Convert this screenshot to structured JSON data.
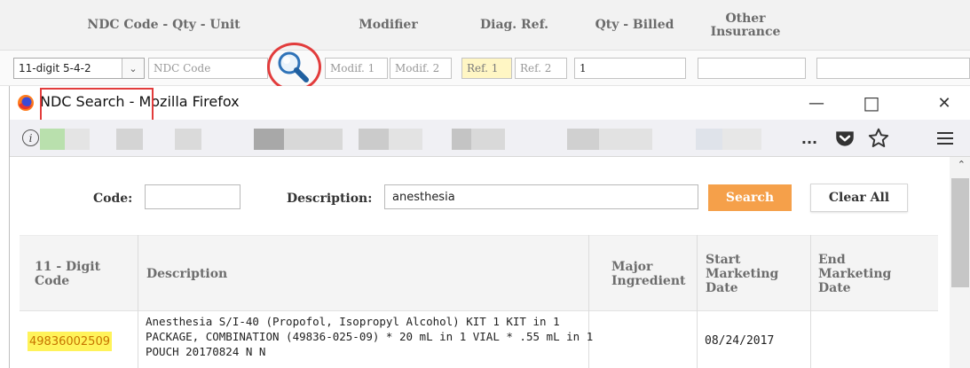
{
  "claim_grid": {
    "headers": [
      "NDC Code - Qty - Unit",
      "Modifier",
      "Diag. Ref.",
      "Qty - Billed",
      "Other Insurance"
    ],
    "ndc_format_value": "11-digit 5-4-2",
    "ndc_code_placeholder": "NDC Code",
    "modifier_1_placeholder": "Modif. 1",
    "modifier_2_placeholder": "Modif. 2",
    "ref_1_placeholder": "Ref. 1",
    "ref_2_placeholder": "Ref. 2",
    "qty_billed_value": "1"
  },
  "window": {
    "title_page": "NDC Search",
    "title_app": " - Mozilla Firefox",
    "more_icon": "...",
    "minimize_icon": "—",
    "maximize_icon": "□",
    "close_icon": "✕"
  },
  "search_form": {
    "code_label": "Code:",
    "code_value": "",
    "description_label": "Description:",
    "description_value": "anesthesia",
    "search_button": "Search",
    "clear_button": "Clear All"
  },
  "results": {
    "columns": [
      "11 - Digit Code",
      "Description",
      "Major Ingredient",
      "Start Marketing Date",
      "End Marketing Date"
    ],
    "rows": [
      {
        "code": "49836002509",
        "description": "Anesthesia S/I-40 (Propofol, Isopropyl Alcohol) KIT 1 KIT in 1 PACKAGE, COMBINATION (49836-025-09) * 20 mL in 1 VIAL * .55 mL in 1 POUCH 20170824 N N",
        "major_ingredient": "",
        "start_date": "08/24/2017",
        "end_date": ""
      }
    ]
  },
  "colors": {
    "accent_search": "#f5a04a",
    "highlight_red": "#e23c3c",
    "code_highlight": "#fff35a"
  }
}
